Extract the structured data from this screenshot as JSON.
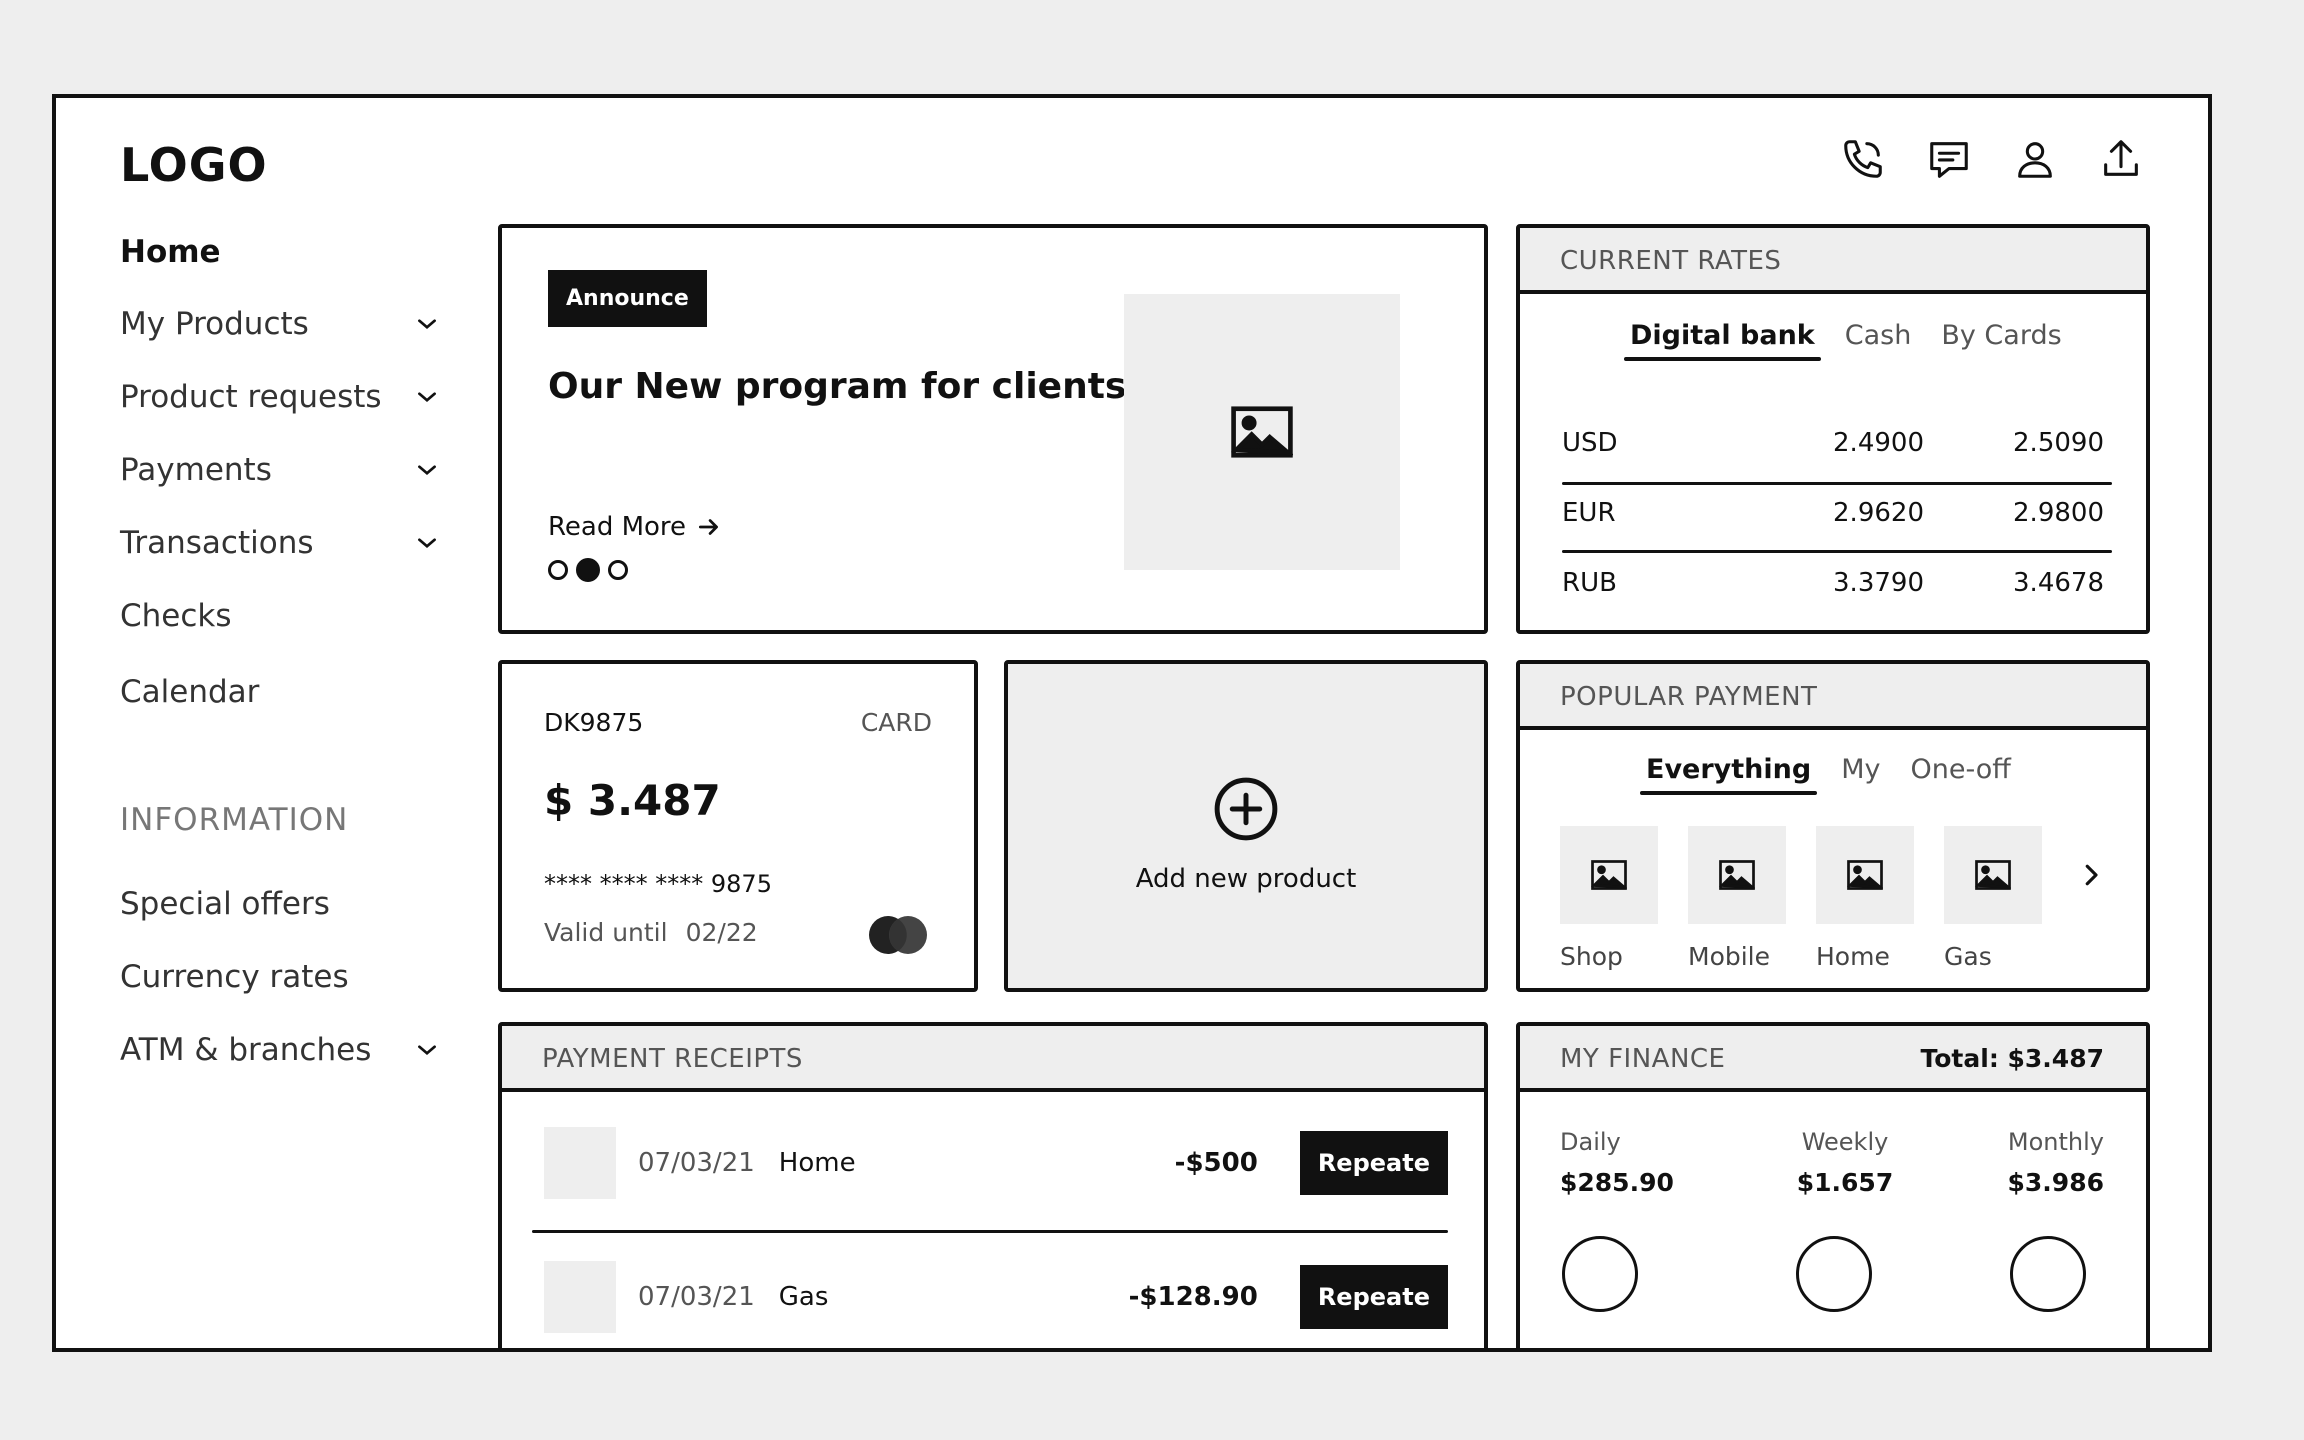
{
  "header": {
    "logo": "LOGO",
    "icons": [
      "phone-icon",
      "chat-icon",
      "user-icon",
      "upload-icon"
    ]
  },
  "sidebar": {
    "items": [
      {
        "label": "Home",
        "expandable": false,
        "active": true
      },
      {
        "label": "My Products",
        "expandable": true
      },
      {
        "label": "Product requests",
        "expandable": true
      },
      {
        "label": "Payments",
        "expandable": true
      },
      {
        "label": "Transactions",
        "expandable": true
      },
      {
        "label": "Checks",
        "expandable": false
      },
      {
        "label": "Calendar",
        "expandable": false
      }
    ],
    "section_title": "INFORMATION",
    "info_items": [
      {
        "label": "Special offers",
        "expandable": false
      },
      {
        "label": "Currency rates",
        "expandable": false
      },
      {
        "label": "ATM & branches",
        "expandable": true
      }
    ]
  },
  "announce": {
    "badge": "Announce",
    "title": "Our New program for clients",
    "read_more": "Read More",
    "slides": 3,
    "active_slide": 1
  },
  "rates": {
    "title": "CURRENT RATES",
    "tabs": [
      "Digital bank",
      "Cash",
      "By Cards"
    ],
    "active_tab": 0,
    "rows": [
      {
        "currency": "USD",
        "buy": "2.4900",
        "sell": "2.5090"
      },
      {
        "currency": "EUR",
        "buy": "2.9620",
        "sell": "2.9800"
      },
      {
        "currency": "RUB",
        "buy": "3.3790",
        "sell": "3.4678"
      }
    ]
  },
  "bank_card": {
    "id": "DK9875",
    "type": "CARD",
    "amount": "$ 3.487",
    "number": "**** **** **** 9875",
    "valid_label": "Valid until",
    "valid_date": "02/22",
    "brand": "MasterCard"
  },
  "add_product": {
    "label": "Add new product"
  },
  "popular": {
    "title": "POPULAR PAYMENT",
    "tabs": [
      "Everything",
      "My",
      "One-off"
    ],
    "active_tab": 0,
    "items": [
      {
        "label": "Shop"
      },
      {
        "label": "Mobile"
      },
      {
        "label": "Home"
      },
      {
        "label": "Gas"
      }
    ]
  },
  "receipts": {
    "title": "PAYMENT RECEIPTS",
    "rows": [
      {
        "date": "07/03/21",
        "name": "Home",
        "amount": "-$500",
        "action": "Repeate"
      },
      {
        "date": "07/03/21",
        "name": "Gas",
        "amount": "-$128.90",
        "action": "Repeate"
      }
    ]
  },
  "finance": {
    "title": "MY FINANCE",
    "total": "Total: $3.487",
    "periods": [
      {
        "label": "Daily",
        "value": "$285.90"
      },
      {
        "label": "Weekly",
        "value": "$1.657"
      },
      {
        "label": "Monthly",
        "value": "$3.986"
      }
    ]
  }
}
